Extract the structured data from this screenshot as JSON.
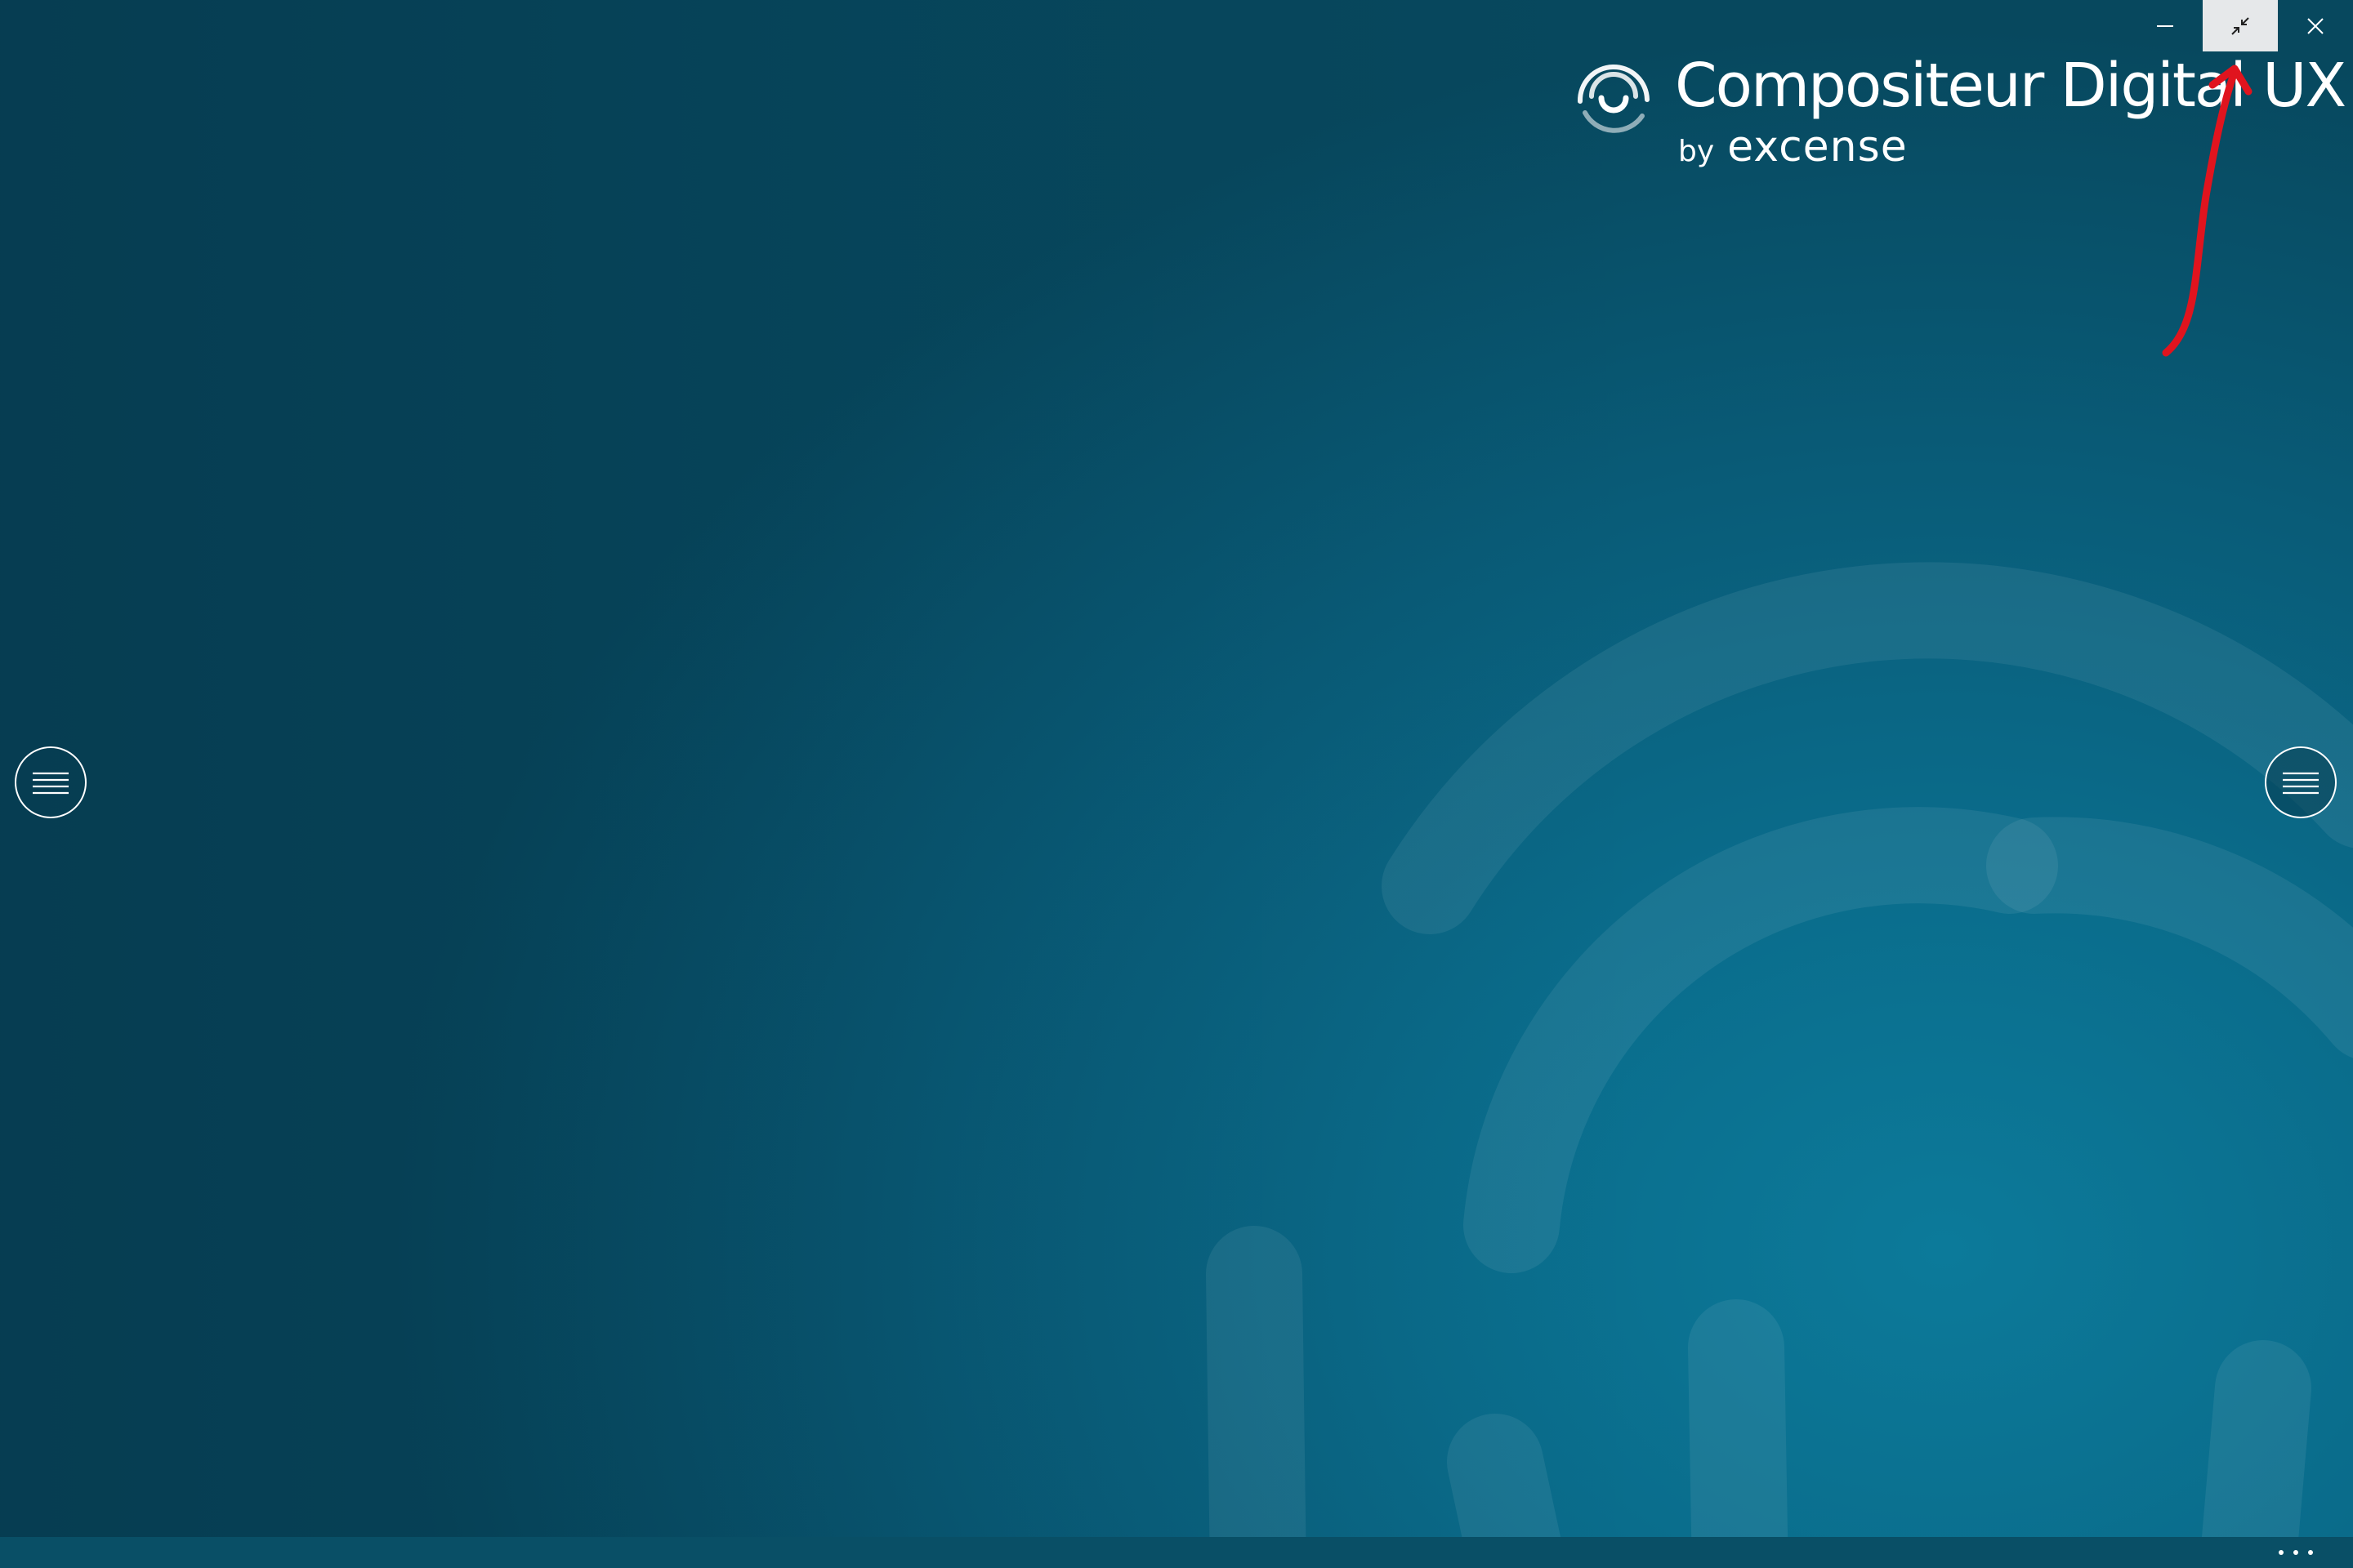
{
  "app": {
    "title": "Compositeur Digital UX",
    "byline": "by",
    "company": "excense"
  },
  "window_controls": {
    "minimize_icon": "minimize-icon",
    "restore_icon": "exit-fullscreen-icon",
    "close_icon": "close-icon",
    "active": "restore"
  },
  "side_menus": {
    "left_icon": "hamburger-menu-icon",
    "right_icon": "hamburger-menu-icon"
  },
  "bottom_bar": {
    "more_icon": "more-ellipsis-icon"
  },
  "annotation": {
    "type": "red-arrow",
    "color": "#e0141e",
    "points_to": "restore-button"
  },
  "colors": {
    "background": "#0a6b8a",
    "background_dark": "#07485e",
    "bottom_bar": "#094f66",
    "active_button": "#e6e8ea",
    "foreground": "#ffffff"
  }
}
